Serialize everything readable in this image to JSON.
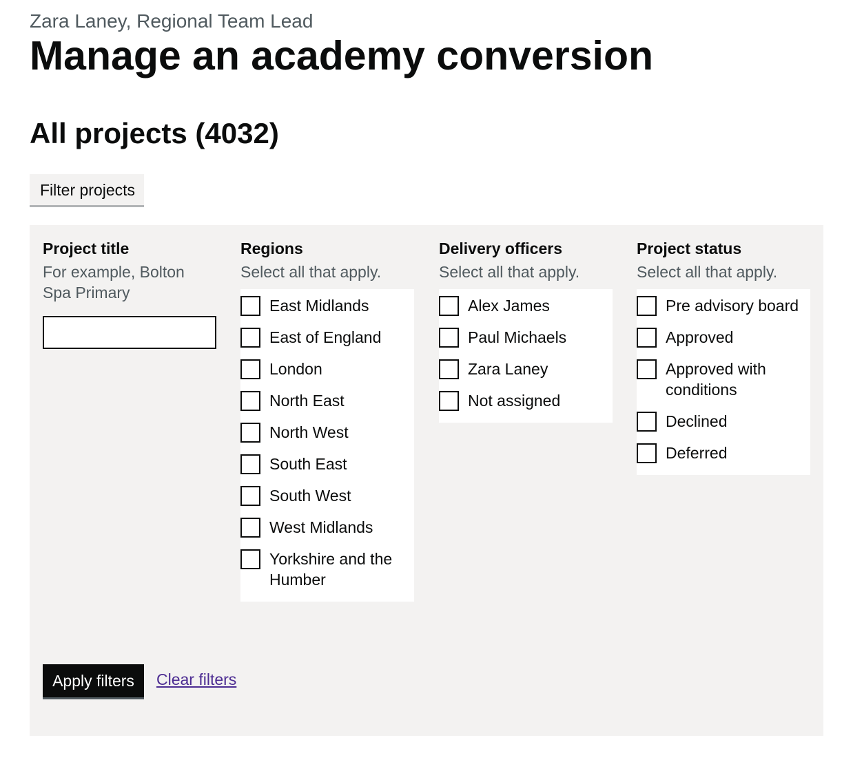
{
  "header": {
    "caption": "Zara Laney, Regional Team Lead",
    "title": "Manage an academy conversion"
  },
  "projects_heading": "All projects (4032)",
  "filter_toggle_label": "Filter projects",
  "filters": {
    "project_title": {
      "legend": "Project title",
      "hint": "For example, Bolton Spa Primary",
      "value": ""
    },
    "regions": {
      "legend": "Regions",
      "hint": "Select all that apply.",
      "options": [
        "East Midlands",
        "East of England",
        "London",
        "North East",
        "North West",
        "South East",
        "South West",
        "West Midlands",
        "Yorkshire and the Humber"
      ]
    },
    "delivery_officers": {
      "legend": "Delivery officers",
      "hint": "Select all that apply.",
      "options": [
        "Alex James",
        "Paul Michaels",
        "Zara Laney",
        "Not assigned"
      ]
    },
    "project_status": {
      "legend": "Project status",
      "hint": "Select all that apply.",
      "options": [
        "Pre advisory board",
        "Approved",
        "Approved with conditions",
        "Declined",
        "Deferred"
      ]
    }
  },
  "actions": {
    "apply_label": "Apply filters",
    "clear_label": "Clear filters"
  },
  "colors": {
    "panel_bg": "#f3f2f1",
    "text": "#0b0c0c",
    "hint": "#505a5f",
    "link": "#4c2c92"
  }
}
